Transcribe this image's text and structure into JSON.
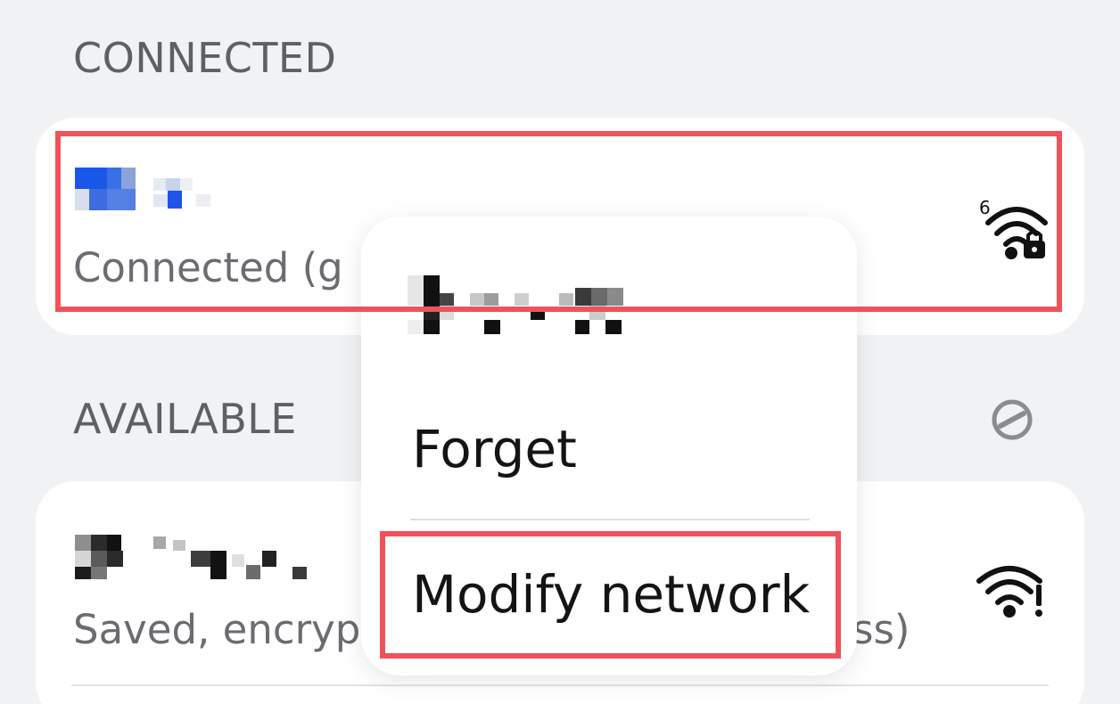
{
  "sections": {
    "connected_header": "CONNECTED",
    "available_header": "AVAILABLE"
  },
  "connected_network": {
    "status": "Connected (g",
    "wifi_icon": "wifi-6-locked-icon",
    "wifi_standard": "6"
  },
  "available_network": {
    "status_head": "Saved, encryp",
    "status_tail": "ss)",
    "wifi_icon": "wifi-warning-icon"
  },
  "menu": {
    "items": [
      "Forget",
      "Modify network"
    ]
  },
  "colors": {
    "background": "#f1f2f4",
    "card": "#ffffff",
    "highlight": "#f0525a",
    "header_text": "#5e6065"
  }
}
